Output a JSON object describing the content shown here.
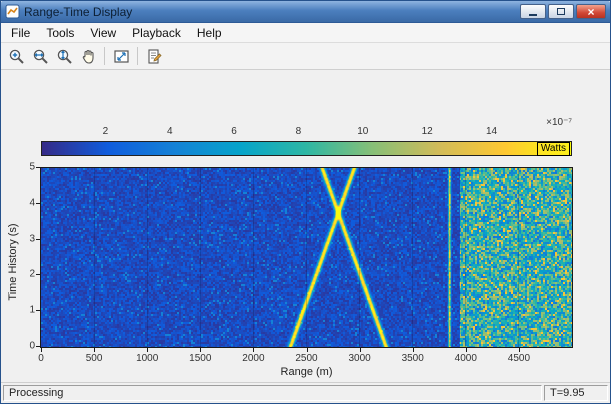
{
  "window": {
    "title": "Range-Time Display"
  },
  "menu": {
    "items": [
      "File",
      "Tools",
      "View",
      "Playback",
      "Help"
    ]
  },
  "toolbar": {
    "icons": [
      "zoom-in",
      "zoom-x",
      "zoom-y",
      "pan",
      "scale-to-fit",
      "measurements"
    ]
  },
  "colorbar": {
    "ticks": [
      2,
      4,
      6,
      8,
      10,
      12,
      14
    ],
    "range": [
      0,
      16.5
    ],
    "multiplier": "×10⁻⁷",
    "label": "Watts",
    "colors": [
      "#352a87",
      "#0f5cdd",
      "#1481d6",
      "#06a4ca",
      "#2eb7a4",
      "#87bf77",
      "#d1bb59",
      "#fec832",
      "#f9fb0e"
    ]
  },
  "chart_data": {
    "type": "heatmap",
    "xlabel": "Range (m)",
    "ylabel": "Time History (s)",
    "x_ticks": [
      0,
      500,
      1000,
      1500,
      2000,
      2500,
      3000,
      3500,
      4000,
      4500
    ],
    "y_ticks": [
      0,
      1,
      2,
      3,
      4,
      5
    ],
    "x_range": [
      0,
      5000
    ],
    "y_range": [
      0,
      5
    ],
    "intensity_units": "Watts",
    "intensity_scale": "1e-7",
    "features": {
      "receding_track": {
        "range_at_t0": 2350,
        "range_at_t5": 2950
      },
      "approaching_track": {
        "range_at_t0": 3250,
        "range_at_t5": 2650
      },
      "tracks_cross": {
        "range": 2800,
        "time": 3.75
      },
      "stationary_return_range": 3850,
      "clutter_region_start": 3950
    }
  },
  "statusbar": {
    "left": "Processing",
    "right": "T=9.95"
  }
}
